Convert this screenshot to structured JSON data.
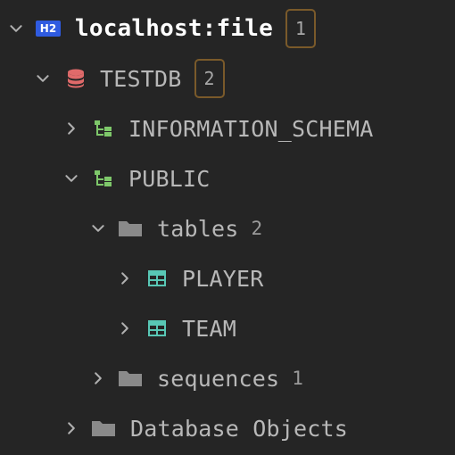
{
  "colors": {
    "background": "#252525",
    "connection_icon": "#2f5be0",
    "database_icon": "#e06a6a",
    "schema_icon": "#7ec86a",
    "table_icon": "#58c7b5",
    "folder_icon": "#8a8a8a",
    "badge_border": "#7a5a2a"
  },
  "tree": {
    "connection": {
      "icon": "h2-icon",
      "icon_text": "H2",
      "label": "localhost:file",
      "badge": "1",
      "expanded": true
    },
    "database": {
      "icon": "database-icon",
      "label": "TESTDB",
      "badge": "2",
      "expanded": true
    },
    "schemas": [
      {
        "icon": "schema-icon",
        "label": "INFORMATION_SCHEMA",
        "expanded": false
      },
      {
        "icon": "schema-icon",
        "label": "PUBLIC",
        "expanded": true
      }
    ],
    "tables_folder": {
      "icon": "folder-icon",
      "label": "tables",
      "count": "2",
      "expanded": true
    },
    "tables": [
      {
        "icon": "table-icon",
        "label": "PLAYER",
        "expanded": false
      },
      {
        "icon": "table-icon",
        "label": "TEAM",
        "expanded": false
      }
    ],
    "sequences_folder": {
      "icon": "folder-icon",
      "label": "sequences",
      "count": "1",
      "expanded": false
    },
    "database_objects": {
      "icon": "folder-icon",
      "label": "Database Objects",
      "expanded": false
    }
  }
}
